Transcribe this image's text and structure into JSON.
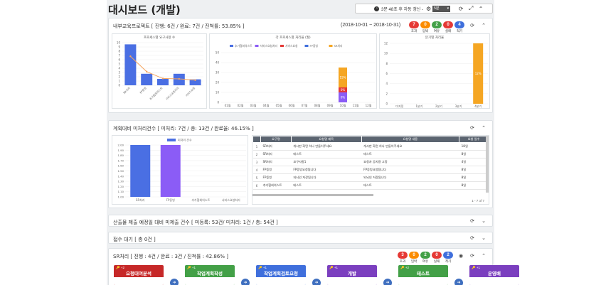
{
  "header": {
    "title": "대시보드 (개발)",
    "refresh_text": "3분 48초 후 자동 갱신 -",
    "interval": "5분"
  },
  "icons": {
    "clock": "clock-icon",
    "gear": "gear-icon",
    "refresh": "refresh-icon",
    "expand": "expand-icon",
    "collapse": "chevron-up-icon",
    "chevron_down": "chevron-down-icon",
    "eye": "eye-icon",
    "key": "key-icon"
  },
  "panel1": {
    "title": "내부교육프로젝트  [ 진행: 6건 / 완료: 7건 / 진척률: 53.85% ]",
    "date_range": "(2018-10-01 ~ 2018-10-31)",
    "badges": [
      {
        "count": "7",
        "label": "초과",
        "color": "#e53935"
      },
      {
        "count": "0",
        "label": "임박",
        "color": "#fb8c00"
      },
      {
        "count": "2",
        "label": "여유",
        "color": "#43a047"
      },
      {
        "count": "0",
        "label": "실패",
        "color": "#e53935"
      },
      {
        "count": "4",
        "label": "적기",
        "color": "#3f6fdc"
      }
    ]
  },
  "panel2": {
    "title": "계획대비 미처리건수  [ 미처리: 7건 / 총: 13건 / 완료율: 46.15% ]"
  },
  "panel3": {
    "title": "산출물 제출 예정일 대비 미제출 건수  [ 미등록: 53건/ 미처리: 1건 / 총: 54건 ]"
  },
  "panel4": {
    "title": "접수 대기 [ 총 0건 ]"
  },
  "panel5": {
    "title": "SR처리 [ 진행 : 4건 / 완료 : 3건 / 진척률 : 42.86% ]",
    "badges": [
      {
        "count": "3",
        "label": "초과",
        "color": "#e53935"
      },
      {
        "count": "0",
        "label": "임박",
        "color": "#fb8c00"
      },
      {
        "count": "2",
        "label": "여유",
        "color": "#43a047"
      },
      {
        "count": "0",
        "label": "실패",
        "color": "#e53935"
      },
      {
        "count": "2",
        "label": "적기",
        "color": "#3f6fdc"
      }
    ],
    "cards": [
      {
        "badge": "+2",
        "name": "요청대여분석",
        "color": "#c62828"
      },
      {
        "badge": "+1",
        "name": "작업계획작성",
        "color": "#43a047"
      },
      {
        "badge": "+1",
        "name": "작업계획검토요청",
        "color": "#3f6fdc"
      },
      {
        "badge": "+1",
        "name": "개발",
        "color": "#7b3fbf"
      },
      {
        "badge": "+2",
        "name": "테스트",
        "color": "#43a047"
      },
      {
        "badge": "+1",
        "name": "운영배",
        "color": "#7b3fbf"
      }
    ]
  },
  "table": {
    "headers": [
      "요구명",
      "요청명 제목",
      "요청명 내용",
      "요청 일수"
    ],
    "rows": [
      [
        "1",
        "SR처리",
        "개시판 화면 하나 만들어주세요",
        "개시판 화면 하나 만들어주세요",
        "18일"
      ],
      [
        "2",
        "SR처리",
        "테스트",
        "테스트",
        "8일"
      ],
      [
        "3",
        "SR처리",
        "요구사항1",
        "요청자 공지용 고정",
        "4일"
      ],
      [
        "4",
        "FP증빙",
        "FP증빙요청됩니다",
        "FP증빙요청됩니다",
        "8일"
      ],
      [
        "5",
        "FP증빙",
        "되뇌인 저장됩니다",
        "되뇌인 저장됩니다",
        "8일"
      ],
      [
        "6",
        "추가협회의스트",
        "테스트",
        "테스트",
        "8일"
      ]
    ],
    "pager": "1 - 7 of 7"
  },
  "chart_data": [
    {
      "type": "bar",
      "title": "프로세스별 요구사항 수",
      "categories": [
        "SR처리",
        "FP증빙",
        "추가협회의스트",
        "서비스요청처리",
        "서비스요청"
      ],
      "series": [
        {
          "values": [
            9.6,
            2.7,
            1.5,
            2.7,
            1.4
          ]
        }
      ],
      "line_values": [
        6.8,
        3.2,
        1.6,
        1.5,
        1.2
      ],
      "ylim": [
        0,
        10
      ],
      "yticks": [
        "0",
        "1",
        "2",
        "3",
        "4",
        "5",
        "6",
        "7",
        "8",
        "9",
        "10"
      ],
      "line_color": "#f4a460",
      "bar_color": "#4a6fe3"
    },
    {
      "type": "bar",
      "title": "각 프로세스별 처리율 (월)",
      "categories": [
        "01월",
        "02월",
        "03월",
        "04월",
        "05월",
        "06월",
        "07월",
        "08월",
        "09월",
        "10월",
        "11월",
        "12월"
      ],
      "legend": [
        "추가협회의스트",
        "서비스요청처리",
        "서비스요청",
        "FP증빙",
        "SR처리"
      ],
      "legend_colors": [
        "#4a6fe3",
        "#8b5cf6",
        "#e53935",
        "#3f6fdc",
        "#f5a623"
      ],
      "stack_values": [
        {
          "month": "10월",
          "segments": [
            {
              "value": 10,
              "label": "0%",
              "color": "#8b5cf6"
            },
            {
              "value": 5,
              "label": "0%",
              "color": "#e53935"
            },
            {
              "value": 20,
              "label": "15%",
              "color": "#f5a623"
            }
          ]
        }
      ],
      "ylim": [
        0,
        50
      ],
      "yticks": [
        "0",
        "10",
        "20",
        "30",
        "40",
        "50"
      ]
    },
    {
      "type": "bar",
      "title": "분기별 처리율",
      "categories": [
        "미지정",
        "1분기",
        "2분기",
        "3분기",
        "4분기"
      ],
      "series": [
        {
          "values": [
            0,
            0,
            0,
            0,
            12
          ],
          "label": "12%"
        }
      ],
      "ylim": [
        0,
        12
      ],
      "yticks": [
        "0",
        "2",
        "4",
        "6",
        "8",
        "10",
        "12"
      ],
      "bar_color": "#f5a623"
    },
    {
      "type": "bar",
      "title": "",
      "legend": [
        "미처리 건수"
      ],
      "categories": [
        "SR처리",
        "FP증빙",
        "추가협회의스트",
        "서비스요청처리"
      ],
      "series": [
        {
          "name": "미처리 건수",
          "values": [
            2,
            2,
            0,
            0
          ]
        }
      ],
      "ylim": [
        1,
        2
      ],
      "yticks": [
        "1.00",
        "1.10",
        "1.20",
        "1.30",
        "1.40",
        "1.50",
        "1.60",
        "1.70",
        "1.80",
        "1.90",
        "2.00"
      ],
      "bar_colors": [
        "#4a6fe3",
        "#8b5cf6"
      ]
    }
  ]
}
